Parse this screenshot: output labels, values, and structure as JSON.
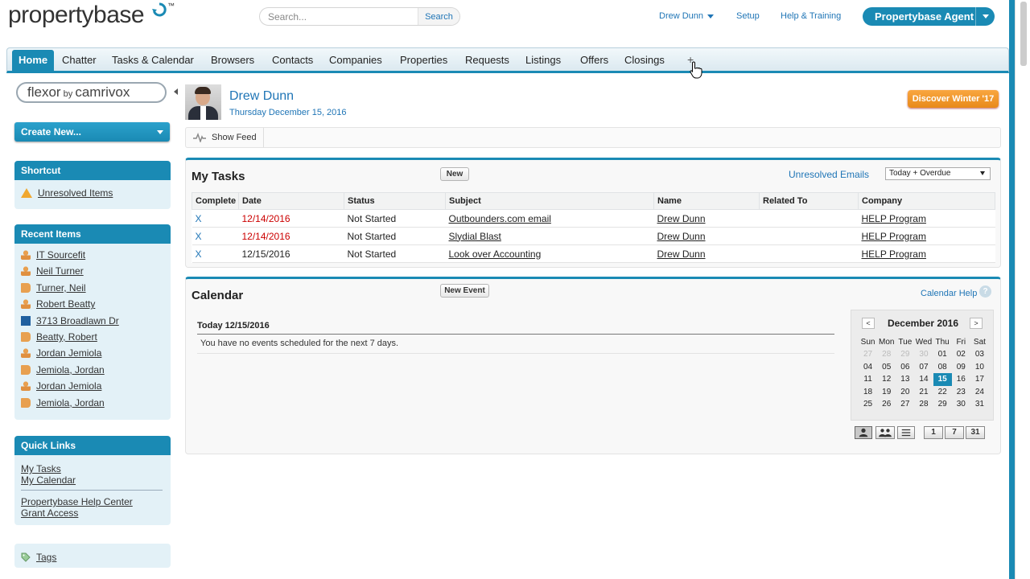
{
  "header": {
    "logo_text": "propertybase",
    "logo_tm": "™",
    "search_placeholder": "Search...",
    "search_button": "Search",
    "user_name": "Drew Dunn",
    "setup": "Setup",
    "help": "Help & Training",
    "app_switcher": "Propertybase Agent"
  },
  "tabs": [
    "Home",
    "Chatter",
    "Tasks & Calendar",
    "Browsers",
    "Contacts",
    "Companies",
    "Properties",
    "Requests",
    "Listings",
    "Offers",
    "Closings"
  ],
  "tab_plus": "+",
  "sidebar": {
    "flexor_brand": "flexor",
    "flexor_by": " by ",
    "flexor_company": "camrivox",
    "create_new": "Create New...",
    "shortcut_title": "Shortcut",
    "shortcut_item": "Unresolved Items",
    "recent_title": "Recent Items",
    "recent_items": [
      {
        "label": "IT Sourcefit",
        "icon": "person"
      },
      {
        "label": "Neil Turner",
        "icon": "person"
      },
      {
        "label": "Turner, Neil",
        "icon": "contact"
      },
      {
        "label": "Robert Beatty",
        "icon": "person"
      },
      {
        "label": "3713 Broadlawn Dr",
        "icon": "listing"
      },
      {
        "label": "Beatty, Robert",
        "icon": "contact"
      },
      {
        "label": "Jordan Jemiola",
        "icon": "person"
      },
      {
        "label": "Jemiola, Jordan",
        "icon": "contact"
      },
      {
        "label": "Jordan Jemiola",
        "icon": "person"
      },
      {
        "label": "Jemiola, Jordan",
        "icon": "contact"
      }
    ],
    "quick_title": "Quick Links",
    "quick_links": [
      "My Tasks",
      "My Calendar",
      "Propertybase Help Center",
      "Grant Access"
    ],
    "tags": "Tags"
  },
  "profile": {
    "name": "Drew Dunn",
    "date": "Thursday December 15, 2016"
  },
  "discover_button": "Discover Winter '17",
  "feed": {
    "label": "Show Feed"
  },
  "tasks": {
    "title": "My Tasks",
    "new_button": "New",
    "unresolved_link": "Unresolved Emails",
    "filter_selected": "Today + Overdue",
    "columns": [
      "Complete",
      "Date",
      "Status",
      "Subject",
      "Name",
      "Related To",
      "Company"
    ],
    "rows": [
      {
        "complete": "X",
        "date": "12/14/2016",
        "overdue": true,
        "status": "Not Started",
        "subject": "Outbounders.com email",
        "name": "Drew Dunn",
        "related": "",
        "company": "HELP Program"
      },
      {
        "complete": "X",
        "date": "12/14/2016",
        "overdue": true,
        "status": "Not Started",
        "subject": "Slydial Blast",
        "name": "Drew Dunn",
        "related": "",
        "company": "HELP Program"
      },
      {
        "complete": "X",
        "date": "12/15/2016",
        "overdue": false,
        "status": "Not Started",
        "subject": "Look over Accounting",
        "name": "Drew Dunn",
        "related": "",
        "company": "HELP Program"
      }
    ]
  },
  "calendar": {
    "title": "Calendar",
    "new_event": "New Event",
    "help_link": "Calendar Help",
    "help_icon": "?",
    "today_heading": "Today 12/15/2016",
    "no_events": "You have no events scheduled for the next 7 days.",
    "mini": {
      "month": "December 2016",
      "prev": "<",
      "next": ">",
      "weekdays": [
        "Sun",
        "Mon",
        "Tue",
        "Wed",
        "Thu",
        "Fri",
        "Sat"
      ],
      "weeks": [
        [
          "27",
          "28",
          "29",
          "30",
          "01",
          "02",
          "03"
        ],
        [
          "04",
          "05",
          "06",
          "07",
          "08",
          "09",
          "10"
        ],
        [
          "11",
          "12",
          "13",
          "14",
          "15",
          "16",
          "17"
        ],
        [
          "18",
          "19",
          "20",
          "21",
          "22",
          "23",
          "24"
        ],
        [
          "25",
          "26",
          "27",
          "28",
          "29",
          "30",
          "31"
        ]
      ],
      "other_month_count": 4,
      "today": "15"
    },
    "view_buttons": [
      "1",
      "7",
      "31"
    ]
  },
  "colors": {
    "accent": "#1a8ab4",
    "link": "#1f75b6",
    "overdue": "#cc0000",
    "discover": "#f29a2e"
  }
}
